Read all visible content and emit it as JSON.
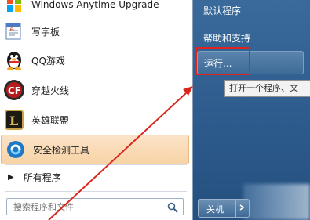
{
  "left_pane": {
    "programs": [
      {
        "label": "Windows Anytime Upgrade",
        "icon": "windows-upgrade-icon"
      },
      {
        "label": "写字板",
        "icon": "wordpad-icon"
      },
      {
        "label": "QQ游戏",
        "icon": "qq-penguin-icon"
      },
      {
        "label": "穿越火线",
        "icon": "crossfire-icon"
      },
      {
        "label": "英雄联盟",
        "icon": "league-of-legends-icon"
      },
      {
        "label": "安全检测工具",
        "icon": "security-tool-icon"
      }
    ],
    "all_programs_label": "所有程序",
    "search_placeholder": "搜索程序和文件"
  },
  "right_pane": {
    "items": [
      "默认程序",
      "帮助和支持"
    ],
    "run_label": "运行...",
    "tooltip": "打开一个程序、文",
    "shutdown_label": "关机"
  },
  "colors": {
    "highlight_box": "#e0231c",
    "annotation_arrow": "#d9261c",
    "right_pane_bg": "#2d5b8c"
  }
}
